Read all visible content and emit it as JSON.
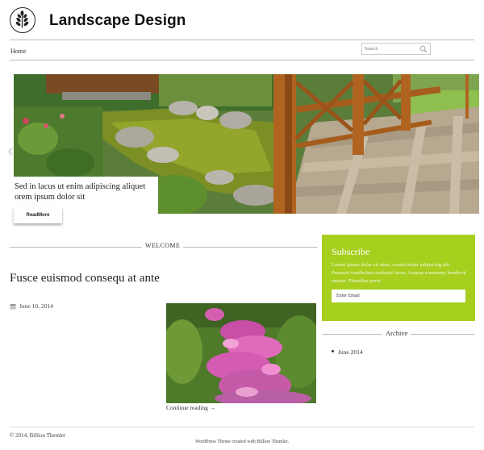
{
  "header": {
    "site_title": "Landscape Design",
    "logo_icon": "plant-sprig-icon"
  },
  "nav": {
    "items": [
      {
        "label": "Home"
      }
    ]
  },
  "search": {
    "placeholder": "Search",
    "icon": "search-icon"
  },
  "slider": {
    "caption": "Sed in lacus ut enim adipiscing aliquet orem ipsum dolor sit",
    "button_label": "ReadMore",
    "prev_icon": "chevron-left-icon"
  },
  "main": {
    "section_heading": "WELCOME",
    "post": {
      "title": "Fusce euismod consequ at ante",
      "date": "June 10, 2014",
      "continue_label": "Continue reading →",
      "date_icon": "calendar-icon"
    }
  },
  "sidebar": {
    "subscribe": {
      "title": "Subscribe",
      "text": "Lorem ipsum dolor sit amet, consectetuer adipiscing elit. Praesent vestibulum molestie lacus. Aenean nonummy hendrerit mauris. Phasellus porta.",
      "email_value": "Enter Email",
      "bg_color": "#a6cf1e"
    },
    "archive": {
      "heading": "Archive",
      "items": [
        {
          "label": "June 2014"
        }
      ]
    }
  },
  "footer": {
    "copyright": "© 2014, Billion Themler",
    "credit": "WordPress Theme created with Billion Themler."
  }
}
